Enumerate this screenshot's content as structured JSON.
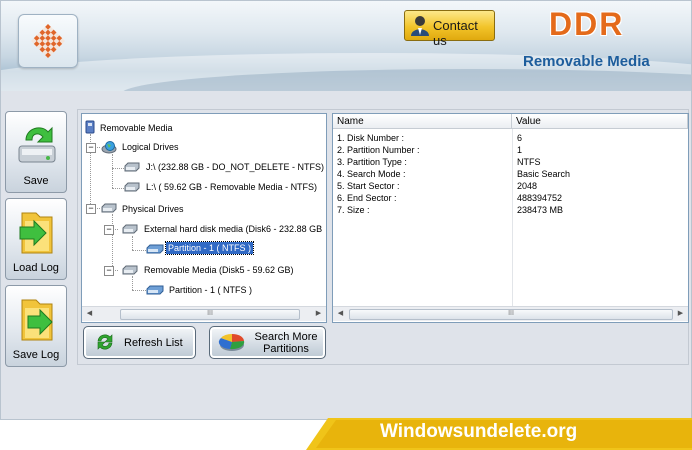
{
  "header": {
    "contact_label": "Contact us",
    "brand": "DDR",
    "brand_subtitle": "Removable Media"
  },
  "sidebar": {
    "save_label": "Save",
    "load_log_label": "Load Log",
    "save_log_label": "Save Log"
  },
  "tree": {
    "root": "Removable Media",
    "logical_drives": "Logical Drives",
    "logical_items": [
      "J:\\ (232.88 GB - DO_NOT_DELETE - NTFS)",
      "L:\\ ( 59.62 GB - Removable Media - NTFS)"
    ],
    "physical_drives": "Physical Drives",
    "disk1": "External hard disk media (Disk6 - 232.88 GB",
    "disk1_partition": "Partition - 1 ( NTFS )",
    "disk2": "Removable Media (Disk5 - 59.62 GB)",
    "disk2_partition": "Partition - 1 ( NTFS )"
  },
  "details": {
    "col_name": "Name",
    "col_value": "Value",
    "rows": [
      {
        "name": "1. Disk Number :",
        "value": "6"
      },
      {
        "name": "2. Partition Number :",
        "value": "1"
      },
      {
        "name": "3. Partition Type :",
        "value": "NTFS"
      },
      {
        "name": "4. Search Mode :",
        "value": "Basic Search"
      },
      {
        "name": "5. Start Sector :",
        "value": "2048"
      },
      {
        "name": "6. End Sector :",
        "value": "488394752"
      },
      {
        "name": "7. Size :",
        "value": "238473 MB"
      }
    ]
  },
  "scroll_thumb_glyph": "III",
  "actions": {
    "refresh_label": "Refresh List",
    "search_more_line1": "Search More",
    "search_more_line2": "Partitions"
  },
  "footer": {
    "website": "Windowsundelete.org"
  },
  "colors": {
    "brand": "#e46a1a",
    "subtitle": "#1d5d9c",
    "selection": "#316ac5",
    "banner": "#f0c419"
  },
  "icons": [
    "checker-logo-icon",
    "user-icon",
    "save-drive-icon",
    "load-log-icon",
    "save-log-icon",
    "drive-icon",
    "refresh-icon",
    "pie-chart-icon"
  ]
}
